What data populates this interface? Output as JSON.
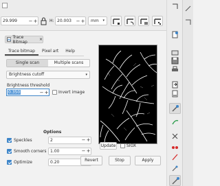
{
  "toolbar": {
    "x_value": "29.999",
    "h_label": "H:",
    "h_value": "20.003",
    "unit": "mm"
  },
  "dialog": {
    "title": "Trace Bitmap",
    "tabs": [
      "Trace bitmap",
      "Pixel art",
      "Help"
    ],
    "modes": [
      "Single scan",
      "Multiple scans"
    ],
    "detection_mode": "Brightness cutoff",
    "threshold_label": "Brightness threshold",
    "threshold_value": "0.350",
    "invert_label": "Invert image",
    "options_heading": "Options",
    "speckles_label": "Speckles",
    "speckles_value": "2",
    "smooth_label": "Smooth corners",
    "smooth_value": "1.00",
    "optimize_label": "Optimize",
    "optimize_value": "0.20",
    "update_label": "Update",
    "siox_label": "SIOX",
    "revert_label": "Revert",
    "stop_label": "Stop",
    "apply_label": "Apply"
  },
  "colors": {
    "accent": "#3e86c9",
    "preview_bg": "#000000"
  },
  "icons": {
    "toolbar": [
      "lock-icon",
      "affect-stroke-icon",
      "affect-corners-icon",
      "affect-gradient-icon",
      "affect-pattern-icon"
    ],
    "right_toolbar": [
      "new-doc-icon",
      "open-doc-icon",
      "save-icon",
      "print-icon",
      "import-icon",
      "export-icon",
      "undo-icon",
      "redo-icon",
      "xml-editor-icon",
      "fill-stroke-icon",
      "text-font-icon",
      "align-icon",
      "trace-icon",
      "snap-icon"
    ]
  }
}
